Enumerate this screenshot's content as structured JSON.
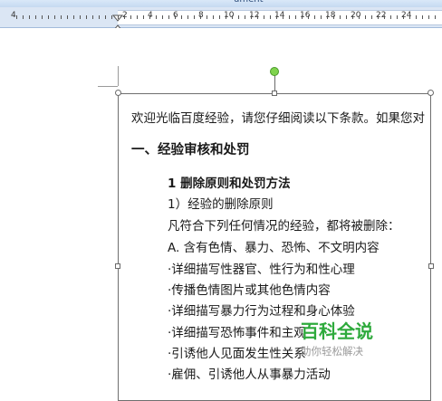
{
  "window": {
    "title": "ument"
  },
  "ruler": {
    "left_number": "4",
    "numbers": [
      "2",
      "2",
      "4",
      "6",
      "8",
      "10",
      "12",
      "14",
      "16",
      "18",
      "20",
      "22",
      "24"
    ]
  },
  "document": {
    "lines": [
      "欢迎光临百度经验，请您仔细阅读以下条款。如果您对",
      "一、经验审核和处罚",
      "1  删除原则和处罚方法",
      "1）经验的删除原则",
      "凡符合下列任何情况的经验，都将被删除：",
      "A. 含有色情、暴力、恐怖、不文明内容",
      "·详细描写性器官、性行为和性心理",
      "·传播色情图片或其他色情内容",
      "·详细描写暴力行为过程和身心体验",
      "·详细描写恐怖事件和主观",
      "·引诱他人见面发生性关系",
      "·雇佣、引诱他人从事暴力活动"
    ]
  },
  "watermark": {
    "title": "百科全说",
    "subtitle": "助你轻松解决"
  }
}
